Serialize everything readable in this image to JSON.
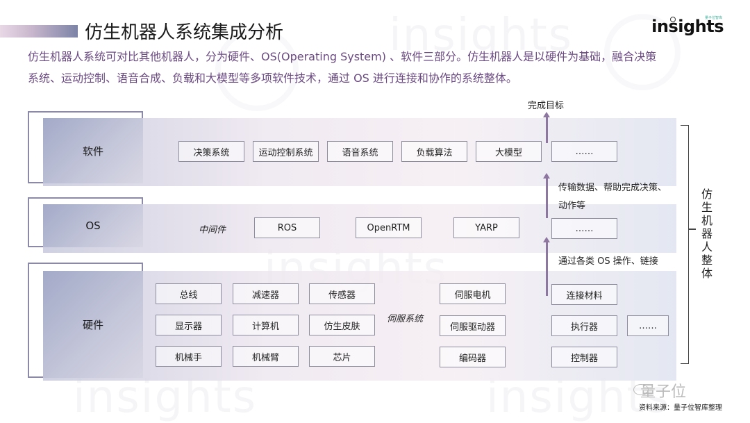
{
  "header": {
    "title": "仿生机器人系统集成分析",
    "description_line1": "仿生机器人系统可对比其他机器人，分为硬件、OS(Operating System) 、软件三部分。仿生机器人是以硬件为基础，融合决策",
    "description_line2": "系统、运动控制、语音合成、负载和大模型等多项软件技术，通过 OS 进行连接和协作的系统整体。",
    "logo_text": "insights",
    "logo_subtext": "量子位智库",
    "watermark_text": "insights"
  },
  "diagram": {
    "software": {
      "label": "软件",
      "items": [
        "决策系统",
        "运动控制系统",
        "语音系统",
        "负载算法",
        "大模型",
        "……"
      ]
    },
    "os": {
      "label": "OS",
      "middleware_label": "中间件",
      "items": [
        "ROS",
        "OpenRTM",
        "YARP",
        "……"
      ]
    },
    "hardware": {
      "label": "硬件",
      "grid": [
        [
          "总线",
          "减速器",
          "传感器"
        ],
        [
          "显示器",
          "计算机",
          "仿生皮肤"
        ],
        [
          "机械手",
          "机械臂",
          "芯片"
        ]
      ],
      "servo_label": "伺服系统",
      "servo_items": [
        "伺服电机",
        "伺服驱动器",
        "编码器"
      ],
      "other_items": [
        "连接材料",
        "执行器",
        "控制器",
        "……"
      ]
    },
    "flow": {
      "goal": "完成目标",
      "os_to_software_line1": "传输数据、帮助完成决策、",
      "os_to_software_line2": "动作等",
      "hardware_to_os": "通过各类 OS 操作、链接"
    },
    "whole_label": "仿生机器人整体"
  },
  "footer": {
    "brand": "量子位",
    "source": "资料来源：量子位智库整理"
  }
}
